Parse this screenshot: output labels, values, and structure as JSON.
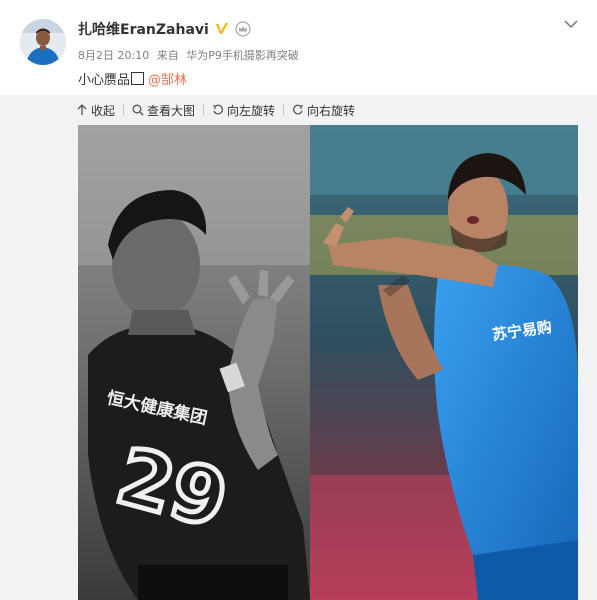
{
  "post": {
    "author": {
      "name": "扎哈维EranZahavi",
      "verified_icon": "verified-badge-icon",
      "vip_icon": "crown-icon"
    },
    "meta": {
      "date": "8月2日 20:10",
      "from_label": "来自",
      "device": "华为P9手机摄影再突破"
    },
    "text": {
      "content": "小心赝品",
      "emoji": "□",
      "mention": "@郜林"
    },
    "more_icon": "chevron-down-icon"
  },
  "toolbar": {
    "collapse_label": "收起",
    "view_large_label": "查看大图",
    "rotate_left_label": "向左旋转",
    "rotate_right_label": "向右旋转"
  },
  "photo": {
    "left_jersey_text": "恒大健康集团",
    "left_jersey_number": "29",
    "right_jersey_text": "苏宁易购"
  },
  "colors": {
    "mention": "#eb7350",
    "meta": "#808080",
    "panel": "#f2f2f5",
    "jersey_blue": "#1a7fd6",
    "verified": "#f7b500"
  }
}
